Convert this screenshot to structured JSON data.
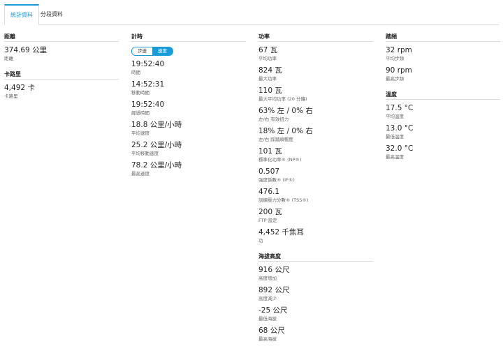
{
  "tabs": [
    {
      "label": "統計資料",
      "active": true
    },
    {
      "label": "分段資料",
      "active": false
    }
  ],
  "colors": {
    "accent": "#1a9bd7",
    "divider": "#dcdcdc"
  },
  "distance": {
    "title": "距離",
    "items": [
      {
        "value": "374.69 公里",
        "label": "距離"
      }
    ]
  },
  "calories": {
    "title": "卡路里",
    "items": [
      {
        "value": "4,492 卡",
        "label": "卡路里"
      }
    ]
  },
  "timing": {
    "title": "計時",
    "toggle": {
      "pace": "步速",
      "speed": "速度",
      "selected": "速度"
    },
    "items": [
      {
        "value": "19:52:40",
        "label": "時間"
      },
      {
        "value": "14:52:31",
        "label": "移動時間"
      },
      {
        "value": "19:52:40",
        "label": "經過時間"
      },
      {
        "value": "18.8 公里/小時",
        "label": "平均速度"
      },
      {
        "value": "25.2 公里/小時",
        "label": "平均移動速度"
      },
      {
        "value": "78.2 公里/小時",
        "label": "最高速度"
      }
    ]
  },
  "power": {
    "title": "功率",
    "items": [
      {
        "value": "67 瓦",
        "label": "平均功率"
      },
      {
        "value": "824 瓦",
        "label": "最大功率"
      },
      {
        "value": "110 瓦",
        "label": "最大平均功率 (20 分鐘)"
      },
      {
        "value": "63% 左 / 0% 右",
        "label": "左/右 有效扭力"
      },
      {
        "value": "18% 左 / 0% 右",
        "label": "左/右 踩踏順暢度"
      },
      {
        "value": "101 瓦",
        "label": "標準化功率® (NP®)"
      },
      {
        "value": "0.507",
        "label": "強度係數® (IF®)"
      },
      {
        "value": "476.1",
        "label": "訓練壓力分數® (TSS®)"
      },
      {
        "value": "200 瓦",
        "label": "FTP 設定"
      },
      {
        "value": "4,452 千焦耳",
        "label": "功"
      }
    ]
  },
  "elevation": {
    "title": "海拔高度",
    "items": [
      {
        "value": "916 公尺",
        "label": "高度增加"
      },
      {
        "value": "892 公尺",
        "label": "高度減少"
      },
      {
        "value": "-25 公尺",
        "label": "最低海拔"
      },
      {
        "value": "68 公尺",
        "label": "最高海拔"
      }
    ]
  },
  "cadence": {
    "title": "踏頻",
    "items": [
      {
        "value": "32 rpm",
        "label": "平均步頻"
      },
      {
        "value": "90 rpm",
        "label": "最高步頻"
      }
    ]
  },
  "temperature": {
    "title": "溫度",
    "items": [
      {
        "value": "17.5 °C",
        "label": "平均溫度"
      },
      {
        "value": "13.0 °C",
        "label": "最低溫度"
      },
      {
        "value": "32.0 °C",
        "label": "最高溫度"
      }
    ]
  }
}
